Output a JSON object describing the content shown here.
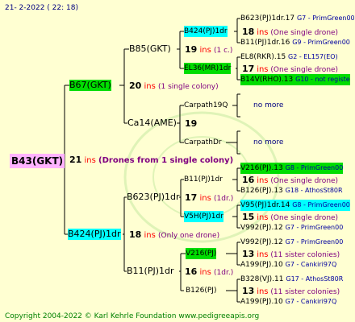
{
  "header": "21-  2-2022 (  22: 18)",
  "footer": "Copyright 2004-2022 © Karl Kehrle Foundation     www.pedigreeapis.org",
  "root": {
    "name": "B43(GKT)",
    "num": "21",
    "ins": "ins",
    "note": "(Drones from 1 single colony)"
  },
  "gen1": [
    {
      "name": "B67(GKT)",
      "num": "20",
      "ins": "ins",
      "note": "(1 single colony)"
    },
    {
      "name": "B424(PJ)1dr",
      "num": "18",
      "ins": "ins",
      "note": "(Only one drone)"
    }
  ],
  "gen2": [
    {
      "name": "B85(GKT)",
      "num": "19",
      "ins": "ins",
      "note": "(1 c.)"
    },
    {
      "name": "Ca14(AME)",
      "num": "19",
      "ins": "",
      "note": ""
    },
    {
      "name": "B623(PJ)1dr",
      "num": "17",
      "ins": "ins",
      "note": "(1dr.)"
    },
    {
      "name": "B11(PJ)1dr",
      "num": "16",
      "ins": "ins",
      "note": "(1dr.)"
    }
  ],
  "gen3": [
    {
      "name": "B424(PJ)1dr",
      "num": "18",
      "ins": "ins",
      "note": "(One single drone)"
    },
    {
      "name": "EL36(MR)1dr",
      "num": "17",
      "ins": "ins",
      "note": "(One single drone)"
    },
    {
      "name": "Carpath19Q",
      "num": "",
      "ins": "",
      "note": ""
    },
    {
      "name": "CarpathDr",
      "num": "",
      "ins": "",
      "note": ""
    },
    {
      "name": "B11(PJ)1dr",
      "num": "16",
      "ins": "ins",
      "note": "(One single drone)"
    },
    {
      "name": "V5H(PJ)1dr",
      "num": "15",
      "ins": "ins",
      "note": "(One single drone)"
    },
    {
      "name": "V216(PJ)",
      "num": "13",
      "ins": "ins",
      "note": "(11 sister colonies)"
    },
    {
      "name": "B126(PJ)",
      "num": "13",
      "ins": "ins",
      "note": "(11 sister colonies)"
    }
  ],
  "gen4": [
    {
      "text": "B623(PJ)1dr.17",
      "src": "G7 - PrimGreen00"
    },
    {
      "text": "B11(PJ)1dr.16",
      "src": "G9 - PrimGreen00"
    },
    {
      "text": "EL8(RKR).15",
      "src": "G2 - EL157(EO)"
    },
    {
      "text": "B14V(RHO).13",
      "src": "G10 - not registe"
    },
    {
      "text": "no more",
      "src": ""
    },
    {
      "text": "no more",
      "src": ""
    },
    {
      "text": "V216(PJ).13",
      "src": "G8 - PrimGreen00"
    },
    {
      "text": "B126(PJ).13",
      "src": "G18 - AthosSt80R"
    },
    {
      "text": "V95(PJ)1dr.14",
      "src": "G8 - PrimGreen00"
    },
    {
      "text": "V992(PJ).12",
      "src": "G7 - PrimGreen00"
    },
    {
      "text": "V992(PJ).12",
      "src": "G7 - PrimGreen00"
    },
    {
      "text": "A199(PJ).10",
      "src": "G7 - Cankiri97Q"
    },
    {
      "text": "B328(VJ).11",
      "src": "G17 - AthosSt80R"
    },
    {
      "text": "A199(PJ).10",
      "src": "G7 - Cankiri97Q"
    }
  ]
}
